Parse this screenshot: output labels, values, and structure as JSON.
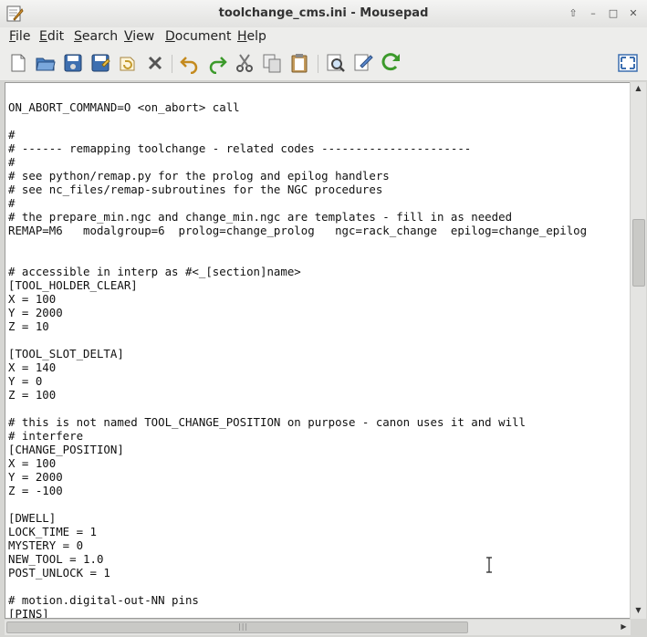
{
  "window": {
    "title": "toolchange_cms.ini - Mousepad"
  },
  "menubar": {
    "file": {
      "u": "F",
      "rest": "ile"
    },
    "edit": {
      "u": "E",
      "rest": "dit"
    },
    "search": {
      "u": "S",
      "rest": "earch"
    },
    "view": {
      "u": "V",
      "rest": "iew"
    },
    "document": {
      "u": "D",
      "rest": "ocument"
    },
    "help": {
      "u": "H",
      "rest": "elp"
    }
  },
  "editor": {
    "content": "\nON_ABORT_COMMAND=O <on_abort> call\n\n#\n# ------ remapping toolchange - related codes ----------------------\n#\n# see python/remap.py for the prolog and epilog handlers\n# see nc_files/remap-subroutines for the NGC procedures\n#\n# the prepare_min.ngc and change_min.ngc are templates - fill in as needed\nREMAP=M6   modalgroup=6  prolog=change_prolog   ngc=rack_change  epilog=change_epilog\n\n\n# accessible in interp as #<_[section]name>\n[TOOL_HOLDER_CLEAR]\nX = 100\nY = 2000\nZ = 10\n\n[TOOL_SLOT_DELTA]\nX = 140\nY = 0\nZ = 100\n\n# this is not named TOOL_CHANGE_POSITION on purpose - canon uses it and will\n# interfere\n[CHANGE_POSITION]\nX = 100\nY = 2000\nZ = -100\n\n[DWELL]\nLOCK_TIME = 1\nMYSTERY = 0\nNEW_TOOL = 1.0\nPOST_UNLOCK = 1\n\n# motion.digital-out-NN pins\n[PINS]"
  }
}
